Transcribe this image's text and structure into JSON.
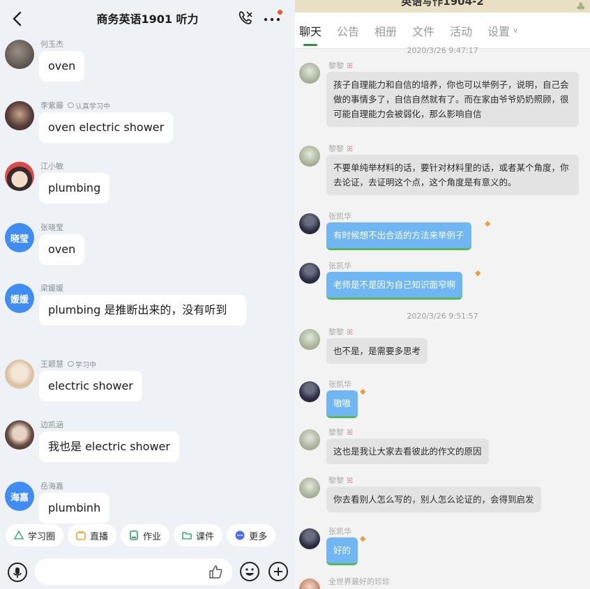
{
  "left": {
    "title": "商务英语1901 听力",
    "messages": [
      {
        "name": "何玉杰",
        "badge": "",
        "avatar_text": "",
        "text": "oven"
      },
      {
        "name": "李紫藤",
        "badge": "认真学习中",
        "avatar_text": "",
        "text": "oven  electric shower"
      },
      {
        "name": "江小敏",
        "badge": "",
        "avatar_text": "",
        "text": "plumbing"
      },
      {
        "name": "张晓莹",
        "badge": "",
        "avatar_text": "晓莹",
        "text": "oven"
      },
      {
        "name": "梁媛媛",
        "badge": "",
        "avatar_text": "媛媛",
        "text": "plumbing 是推断出来的，没有听到"
      },
      {
        "name": "王颖慧",
        "badge": "学习中",
        "avatar_text": "",
        "text": "electric shower"
      },
      {
        "name": "边凯涵",
        "badge": "",
        "avatar_text": "",
        "text": "我也是 electric shower"
      },
      {
        "name": "岳海嘉",
        "badge": "",
        "avatar_text": "海嘉",
        "text": "plumbinh"
      }
    ],
    "tools": [
      {
        "label": "学习圈",
        "icon": "study-circle-icon",
        "color": "#3cb371"
      },
      {
        "label": "直播",
        "icon": "live-icon",
        "color": "#f0a020"
      },
      {
        "label": "作业",
        "icon": "homework-icon",
        "color": "#2f9e6a"
      },
      {
        "label": "课件",
        "icon": "courseware-icon",
        "color": "#2fb36a"
      },
      {
        "label": "更多",
        "icon": "more-icon",
        "color": "#4a6fe8"
      }
    ],
    "input_placeholder": "",
    "accent": "#3f8cf2"
  },
  "right": {
    "top_title": "英语写作1904-2",
    "tabs": [
      {
        "label": "聊天"
      },
      {
        "label": "公告"
      },
      {
        "label": "相册"
      },
      {
        "label": "文件"
      },
      {
        "label": "活动"
      },
      {
        "label": "设置"
      }
    ],
    "timestamp_top": "2020/3/26 9:47:17",
    "timestamp_mid": "2020/3/26 9:51:57",
    "messages": [
      {
        "name": "黎黎",
        "text": "孩子自理能力和自信的培养，你也可以举例子，说明，自己会做的事情多了，自信自然就有了。而在家由爷爷奶奶照顾，很可能自理能力会被弱化，那么影响自信"
      },
      {
        "name": "黎黎",
        "text": "不要单纯举材料的话，要针对材料里的话，或者某个角度，你去论证，去证明这个点，这个角度是有意义的。"
      },
      {
        "name": "张凯华",
        "text": "有时候想不出合适的方法来举例子"
      },
      {
        "name": "张凯华",
        "text": "老师是不是因为自己知识面窄啊"
      },
      {
        "name": "黎黎",
        "text": "也不是，是需要多思考"
      },
      {
        "name": "张凯华",
        "text": "嗷嗷"
      },
      {
        "name": "黎黎",
        "text": "这也是我让大家去看彼此的作文的原因"
      },
      {
        "name": "黎黎",
        "text": "你去看别人怎么写的，别人怎么论证的，会得到启发"
      },
      {
        "name": "张凯华",
        "text": "好的"
      },
      {
        "name": "全世界最好的珍珍",
        "text": ""
      }
    ],
    "active_tab_color": "#2e8f3e"
  }
}
